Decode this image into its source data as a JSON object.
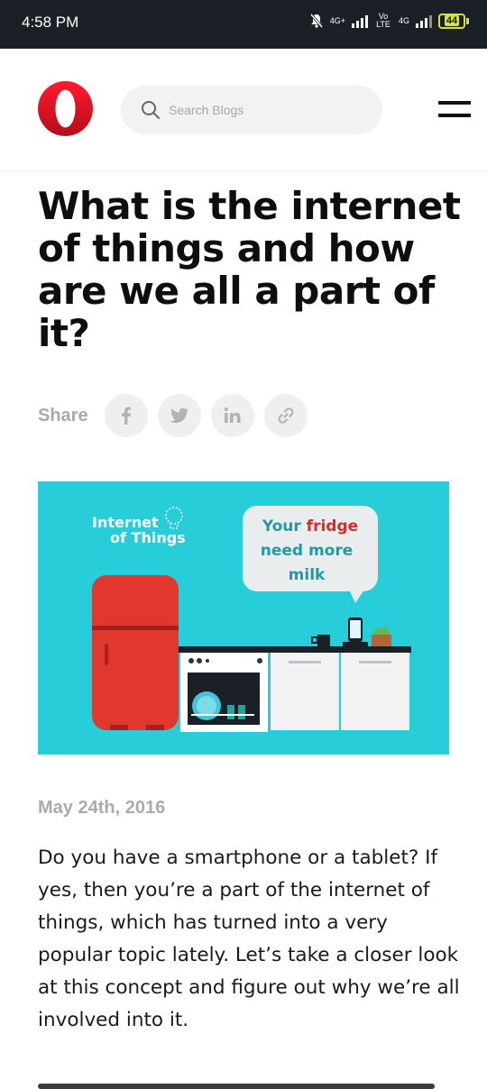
{
  "status_bar": {
    "time": "4:58 PM",
    "network1": "4G+",
    "network2": "Vo LTE",
    "network3": "4G",
    "battery": "44"
  },
  "header": {
    "logo_icon": "opera-logo-icon",
    "search_placeholder": "Search Blogs",
    "menu_icon": "hamburger-menu-icon"
  },
  "article": {
    "title": "What is the internet of things and how are we all a part of it?",
    "share_label": "Share",
    "share_buttons": [
      "facebook-icon",
      "twitter-icon",
      "linkedin-icon",
      "link-icon"
    ],
    "hero": {
      "badge_line1": "Internet",
      "badge_line2": "of Things",
      "bubble_line1_a": "Your ",
      "bubble_line1_b": "fridge",
      "bubble_line2": "need more",
      "bubble_line3": "milk"
    },
    "date": "May 24th, 2016",
    "body": "Do you have a smartphone or a tablet? If yes, then you’re a part of the internet of things, which has turned into a very popular topic lately. Let’s take a closer look at this concept and figure out why we’re all involved into it."
  },
  "colors": {
    "brand_red": "#e3121b",
    "hero_bg": "#27cdd9",
    "status_bg": "#1b1f26",
    "accent_yellow": "#d6e04a"
  }
}
